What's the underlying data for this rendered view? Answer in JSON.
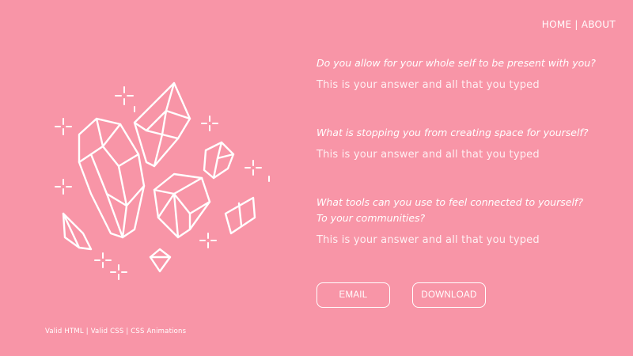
{
  "colors": {
    "background": "#f895a7",
    "foreground": "#ffffff"
  },
  "nav": {
    "home": "HOME",
    "separator": "|",
    "about": "ABOUT"
  },
  "qa": [
    {
      "question": "Do you allow for your whole self to be present with you?",
      "answer": "This is your answer and all that you typed"
    },
    {
      "question": "What is stopping you from creating space for yourself?",
      "answer": "This is your answer and all that you typed"
    },
    {
      "question_line1": "What tools can you use to feel connected to yourself?",
      "question_line2": "To your communities?",
      "answer": "This is your answer and all that you typed"
    }
  ],
  "buttons": {
    "email": "EMAIL",
    "download": "DOWNLOAD"
  },
  "footer": {
    "text": "Valid HTML | Valid CSS | CSS Animations"
  },
  "illustration": {
    "icon": "crystals-icon"
  }
}
